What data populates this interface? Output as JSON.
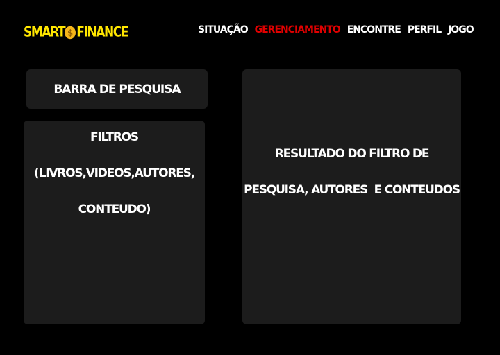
{
  "header": {
    "logo": {
      "left": "SMART",
      "coin_symbol": "$",
      "right": "FINANCE"
    },
    "nav": [
      {
        "label": "SITUAÇÃO",
        "active": false
      },
      {
        "label": "GERENCIAMENTO",
        "active": true
      },
      {
        "label": "ENCONTRE",
        "active": false
      },
      {
        "label": "PERFIL",
        "active": false
      },
      {
        "label": "JOGO",
        "active": false
      }
    ]
  },
  "search": {
    "label": "BARRA DE PESQUISA"
  },
  "filters": {
    "lines": [
      "FILTROS",
      "(LIVROS,VIDEOS,AUTORES,",
      "CONTEUDO)"
    ]
  },
  "results": {
    "lines": [
      "RESULTADO DO FILTRO DE",
      "PESQUISA, AUTORES  E CONTEUDOS"
    ]
  },
  "colors": {
    "background": "#000000",
    "panel": "#1c1c1c",
    "logo": "#ffe600",
    "coin": "#f5b51a",
    "nav_active": "#e00000",
    "text": "#ffffff"
  }
}
